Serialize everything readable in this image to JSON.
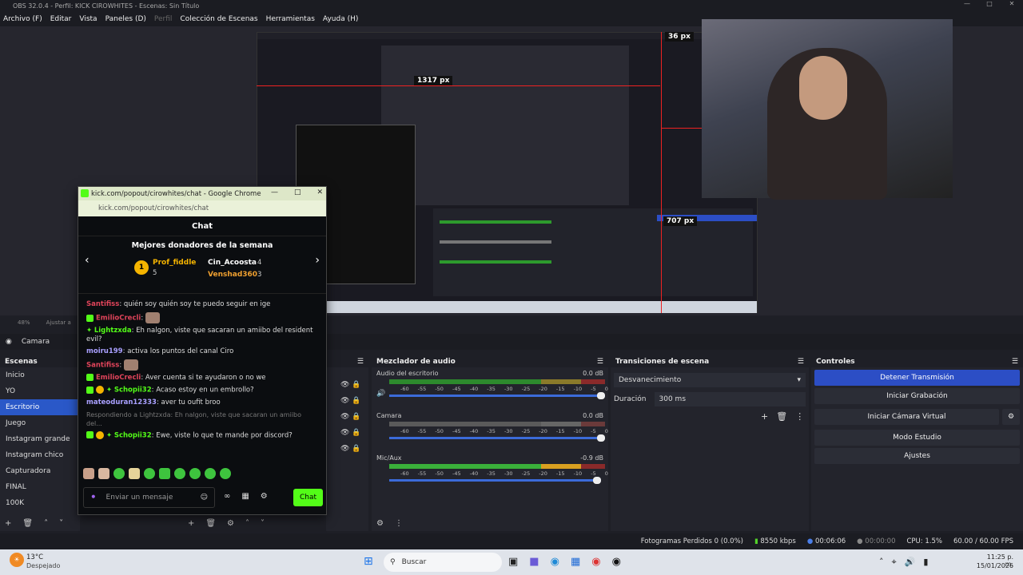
{
  "window": {
    "title": "OBS 32.0.4 - Perfil: KICK CIROWHITES - Escenas: Sin Título"
  },
  "menu": [
    "Archivo (F)",
    "Editar",
    "Vista",
    "Paneles (D)",
    "Perfil",
    "Colección de Escenas",
    "Herramientas",
    "Ayuda (H)"
  ],
  "preview": {
    "measure1": "1317 px",
    "measure2": "707 px",
    "measure3": "36 px",
    "zoom": "48%",
    "fit": "Ajustar a"
  },
  "source_bar": {
    "label": "Camara"
  },
  "scenes": {
    "title": "Escenas",
    "items": [
      "Inicio",
      "YO",
      "Escritorio",
      "Juego",
      "Instagram grande",
      "Instagram chico",
      "Capturadora",
      "FINAL",
      "100K"
    ],
    "selected": "Escritorio"
  },
  "mixer": {
    "title": "Mezclador de audio",
    "tracks": [
      {
        "name": "Audio del escritorio",
        "db": "0.0 dB"
      },
      {
        "name": "Camara",
        "db": "0.0 dB"
      },
      {
        "name": "Mic/Aux",
        "db": "-0.9 dB"
      }
    ],
    "ticks": [
      "-60",
      "-55",
      "-50",
      "-45",
      "-40",
      "-35",
      "-30",
      "-25",
      "-20",
      "-15",
      "-10",
      "-5",
      "0"
    ]
  },
  "transitions": {
    "title": "Transiciones de escena",
    "selected": "Desvanecimiento",
    "duration_label": "Duración",
    "duration_value": "300 ms"
  },
  "controls": {
    "title": "Controles",
    "buttons": [
      "Detener Transmisión",
      "Iniciar Grabación",
      "Iniciar Cámara Virtual",
      "Modo Estudio",
      "Ajustes"
    ]
  },
  "status": {
    "dropped": "Fotogramas Perdidos 0 (0.0%)",
    "bitrate": "8550 kbps",
    "stream_time": "00:06:06",
    "rec_time": "00:00:00",
    "cpu": "CPU: 1.5%",
    "fps": "60.00 / 60.00 FPS"
  },
  "chat_window": {
    "title": "kick.com/popout/cirowhites/chat - Google Chrome",
    "url": "kick.com/popout/cirowhites/chat",
    "header": "Chat",
    "donors_title": "Mejores donadores de la semana",
    "donors": [
      {
        "rank": "1",
        "name": "Prof_fiddle",
        "count": "5"
      },
      {
        "name": "Cin_Acoosta",
        "count": "4"
      },
      {
        "name": "Venshad360",
        "count": "3"
      }
    ],
    "messages": [
      {
        "user": "Santifiss",
        "text": "quién soy quién soy te puedo seguir en ige"
      },
      {
        "user": "EmilioCrecli",
        "text": ""
      },
      {
        "user": "Lightzxda",
        "text": "Eh nalgon, viste que sacaran un amiibo del resident evil?"
      },
      {
        "user": "moiru199",
        "text": "activa los puntos del canal Ciro"
      },
      {
        "user": "Santifiss",
        "text": ""
      },
      {
        "user": "EmilioCrecli",
        "text": "Aver cuenta si te ayudaron o no we"
      },
      {
        "user": "Schopii32",
        "text": "Acaso estoy en un embrollo?"
      },
      {
        "user": "mateoduran12333",
        "text": "aver tu oufit broo"
      },
      {
        "user": "Schopii32",
        "text": "Ewe, viste lo que te mande por discord?"
      }
    ],
    "reply_note": "Respondiendo a Lightzxda: Eh nalgon, viste que sacaran un amiibo del...",
    "input_placeholder": "Enviar un mensaje",
    "send_label": "Chat"
  },
  "taskbar": {
    "temp": "13°C",
    "weather": "Despejado",
    "search": "Buscar",
    "time": "11:25 p. m.",
    "date": "15/01/2026"
  },
  "colors": {
    "accent": "#2c4ec5",
    "kick_green": "#53fc18",
    "measure_red": "#e22222"
  }
}
